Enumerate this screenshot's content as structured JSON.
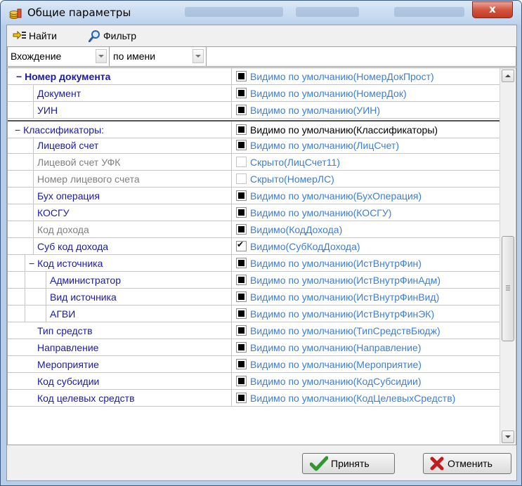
{
  "window": {
    "title": "Общие параметры",
    "close_glyph": "x"
  },
  "toolbar": {
    "find_label": "Найти",
    "filter_label": "Фильтр"
  },
  "search": {
    "mode_value": "Вхождение",
    "field_value": "по имени",
    "query_value": ""
  },
  "rows": [
    {
      "name": "− Номер документа",
      "value": "Видимо по умолчанию(НомерДокПрост)",
      "check": "dot",
      "name_color": "#1a1aa6",
      "value_color": "#3b7fd4",
      "bold": true
    },
    {
      "name": "Документ",
      "value": "Видимо по умолчанию(НомерДок)",
      "check": "dot",
      "name_color": "#1a1aa6",
      "value_color": "#3b7fd4"
    },
    {
      "name": "УИН",
      "value": "Видимо по умолчанию(УИН)",
      "check": "dot",
      "name_color": "#1a1aa6",
      "value_color": "#3b7fd4"
    },
    {
      "name": "− Классификаторы:",
      "value": "Видимо по умолчанию(Классификаторы)",
      "check": "dot",
      "name_color": "#1a1aa6",
      "value_color": "#000000"
    },
    {
      "name": "Лицевой счет",
      "value": "Видимо по умолчанию(ЛицСчет)",
      "check": "dot",
      "name_color": "#1a1aa6",
      "value_color": "#3b7fd4"
    },
    {
      "name": "Лицевой счет УФК",
      "value": "Скрыто(ЛицСчет11)",
      "check": "off",
      "name_color": "#7f7f7f",
      "value_color": "#3b7fd4"
    },
    {
      "name": "Номер лицевого счета",
      "value": "Скрыто(НомерЛС)",
      "check": "off",
      "name_color": "#7f7f7f",
      "value_color": "#3b7fd4"
    },
    {
      "name": "Бух операция",
      "value": "Видимо по умолчанию(БухОперация)",
      "check": "dot",
      "name_color": "#1a1aa6",
      "value_color": "#3b7fd4"
    },
    {
      "name": "КОСГУ",
      "value": "Видимо по умолчанию(КОСГУ)",
      "check": "dot",
      "name_color": "#1a1aa6",
      "value_color": "#3b7fd4"
    },
    {
      "name": "Код дохода",
      "value": "Видимо(КодДохода)",
      "check": "dot",
      "name_color": "#7f7f7f",
      "value_color": "#3b7fd4"
    },
    {
      "name": "Суб код дохода",
      "value": "Видимо(СубКодДохода)",
      "check": "tick",
      "name_color": "#1a1aa6",
      "value_color": "#3b7fd4"
    },
    {
      "name": "− Код источника",
      "value": "Видимо по умолчанию(ИстВнутрФин)",
      "check": "dot",
      "name_color": "#1a1aa6",
      "value_color": "#3b7fd4"
    },
    {
      "name": "Администратор",
      "value": "Видимо по умолчанию(ИстВнутрФинАдм)",
      "check": "dot",
      "name_color": "#1a1aa6",
      "value_color": "#3b7fd4"
    },
    {
      "name": "Вид источника",
      "value": "Видимо по умолчанию(ИстВнутрФинВид)",
      "check": "dot",
      "name_color": "#1a1aa6",
      "value_color": "#3b7fd4"
    },
    {
      "name": "АГВИ",
      "value": "Видимо по умолчанию(ИстВнутрФинЭК)",
      "check": "dot",
      "name_color": "#1a1aa6",
      "value_color": "#3b7fd4"
    },
    {
      "name": "Тип средств",
      "value": "Видимо по умолчанию(ТипСредствБюдж)",
      "check": "dot",
      "name_color": "#1a1aa6",
      "value_color": "#3b7fd4"
    },
    {
      "name": "Направление",
      "value": "Видимо по умолчанию(Направление)",
      "check": "dot",
      "name_color": "#1a1aa6",
      "value_color": "#3b7fd4"
    },
    {
      "name": "Мероприятие",
      "value": "Видимо по умолчанию(Мероприятие)",
      "check": "dot",
      "name_color": "#1a1aa6",
      "value_color": "#3b7fd4"
    },
    {
      "name": "Код субсидии",
      "value": "Видимо по умолчанию(КодСубсидии)",
      "check": "dot",
      "name_color": "#1a1aa6",
      "value_color": "#3b7fd4"
    },
    {
      "name": "Код целевых средств",
      "value": "Видимо по умолчанию(КодЦелевыхСредств)",
      "check": "dot",
      "name_color": "#1a1aa6",
      "value_color": "#3b7fd4"
    }
  ],
  "footer": {
    "accept_label": "Принять",
    "cancel_label": "Отменить"
  },
  "colors": {
    "accent_green": "#2e9a2e",
    "cancel_red": "#c21b1b",
    "tree_guide": "#c6c6c6"
  }
}
